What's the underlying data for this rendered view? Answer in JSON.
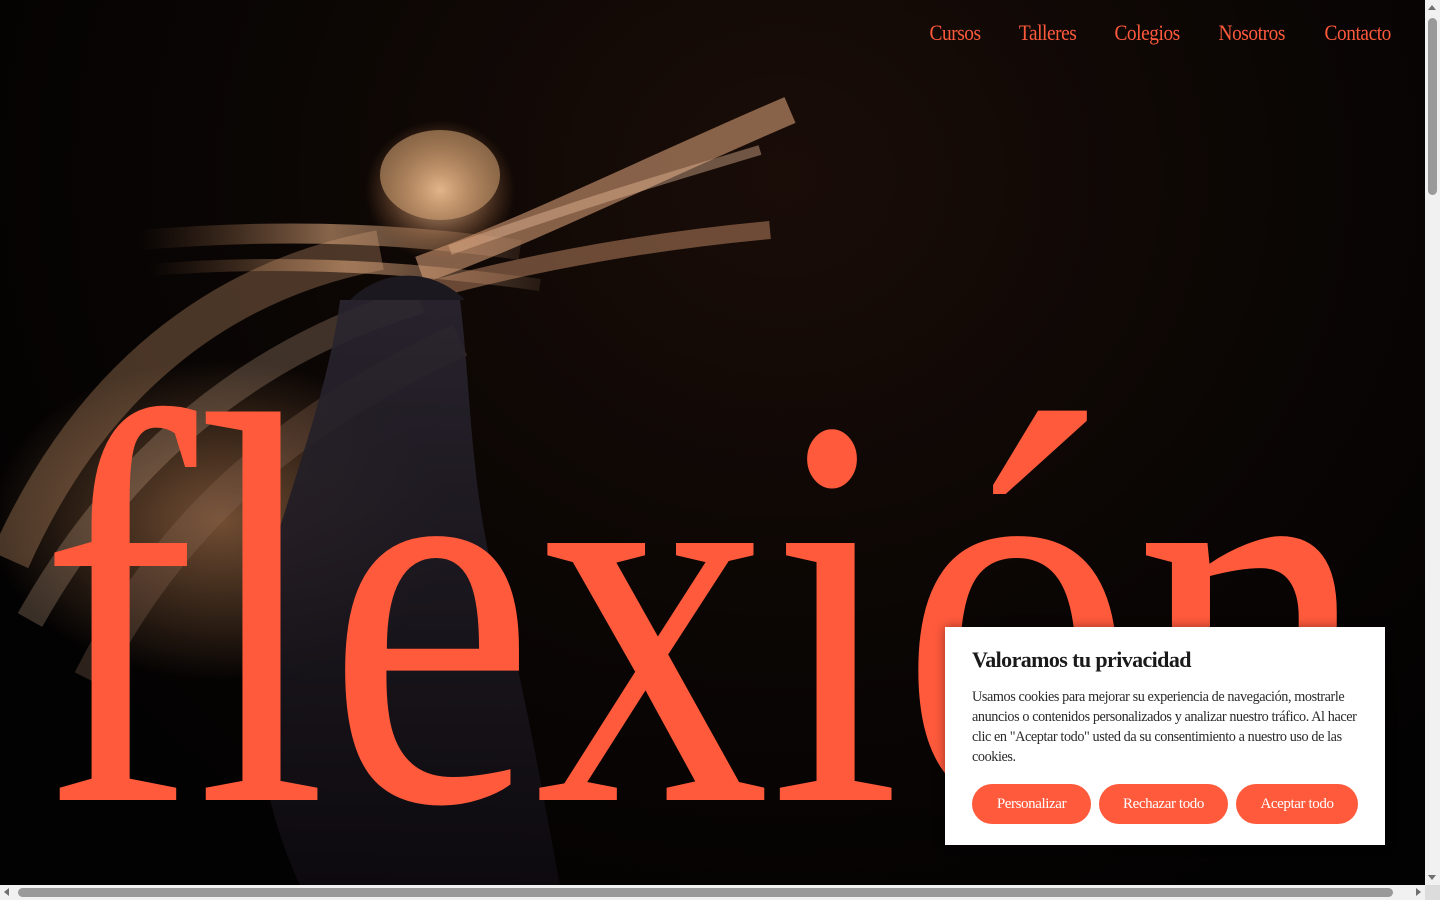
{
  "nav": {
    "items": [
      {
        "label": "Cursos"
      },
      {
        "label": "Talleres"
      },
      {
        "label": "Colegios"
      },
      {
        "label": "Nosotros"
      },
      {
        "label": "Contacto"
      }
    ]
  },
  "hero": {
    "wordmark": "flexión",
    "accent_color": "#ff5a3c"
  },
  "cookie": {
    "title": "Valoramos tu privacidad",
    "body": "Usamos cookies para mejorar su experiencia de navegación, mostrarle anuncios o contenidos personalizados y analizar nuestro tráfico. Al hacer clic en \"Aceptar todo\" usted da su consentimiento a nuestro uso de las cookies.",
    "buttons": {
      "customize": "Personalizar",
      "reject": "Rechazar todo",
      "accept": "Aceptar todo"
    }
  }
}
